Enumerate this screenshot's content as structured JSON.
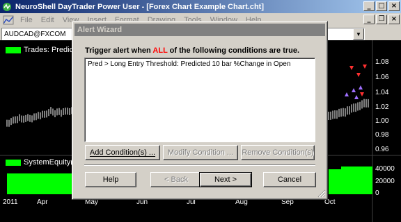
{
  "app": {
    "title": "NeuroShell DayTrader Power User - [Forex Chart Example Chart.cht]",
    "window_buttons": [
      "_",
      "□",
      "×"
    ],
    "mdi_buttons": [
      "_",
      "❐",
      "×"
    ]
  },
  "menu": [
    "File",
    "Edit",
    "View",
    "Insert",
    "Format",
    "Drawing",
    "Tools",
    "Window",
    "Help"
  ],
  "toolbar": {
    "symbol": "AUDCAD@FXCOM"
  },
  "chart": {
    "top_pane_label": "Trades: Predic",
    "bottom_pane_label": "SystemEquity(",
    "y_axis_top": [
      "1.08",
      "1.06",
      "1.04",
      "1.02",
      "1.00",
      "0.98",
      "0.96"
    ],
    "y_axis_bottom": [
      "40000",
      "20000",
      "0"
    ],
    "x_axis": [
      "2011",
      "Apr",
      "May",
      "Jun",
      "Jul",
      "Aug",
      "Sep",
      "Oct"
    ],
    "price_color": "#ffffff",
    "equity_color": "#00ff00",
    "signal_colors": {
      "sell": "#ff3030",
      "buy": "#a070ff"
    }
  },
  "dialog": {
    "title": "Alert Wizard",
    "trigger_prefix": "Trigger alert when ",
    "trigger_all": "ALL",
    "trigger_suffix": " of the following conditions are true.",
    "conditions": [
      "Pred > Long Entry Threshold: Predicted 10 bar %Change in Open"
    ],
    "add_label": "Add Condition(s) ...",
    "modify_label": "Modify Condition ...",
    "remove_label": "Remove Condition(s)",
    "help_label": "Help",
    "back_label": "< Back",
    "next_label": "Next >",
    "cancel_label": "Cancel"
  }
}
